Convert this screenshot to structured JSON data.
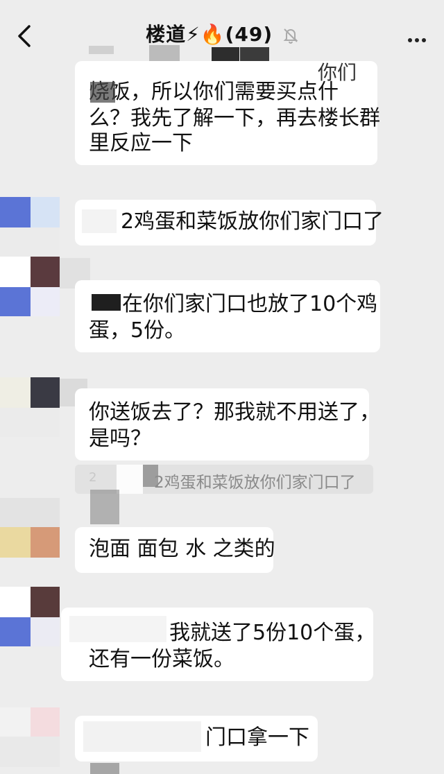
{
  "header": {
    "title": "楼道",
    "emoji": "⚡🔥",
    "count": "(49)",
    "back_icon": "chevron-left-icon",
    "mute_icon": "bell-off-icon",
    "more_icon": "ellipsis-icon"
  },
  "messages": [
    {
      "lines": [
        "你们",
        "烧饭，所以你们需要买点什",
        "么？我先了解一下，再去楼长群",
        "里反应一下"
      ]
    },
    {
      "lines": [
        "2鸡蛋和菜饭放你们家门口了"
      ]
    },
    {
      "lines": [
        "在你们家门口也放了10个鸡",
        "蛋，5份。"
      ]
    },
    {
      "lines": [
        "你送饭去了？那我就不用送了，",
        "是吗？"
      ]
    },
    {
      "quote": "2鸡蛋和菜饭放你们家门口了",
      "quote_prefix": "2"
    },
    {
      "lines": [
        "泡面 面包 水 之类的"
      ]
    },
    {
      "lines": [
        "我就送了5份10个蛋，",
        "还有一份菜饭。"
      ]
    },
    {
      "lines": [
        "门口拿一下"
      ]
    }
  ],
  "colors": {
    "background": "#ededed",
    "bubble": "#ffffff",
    "quote_bg": "#e2e2e2",
    "quote_text": "#8a8a8a"
  }
}
